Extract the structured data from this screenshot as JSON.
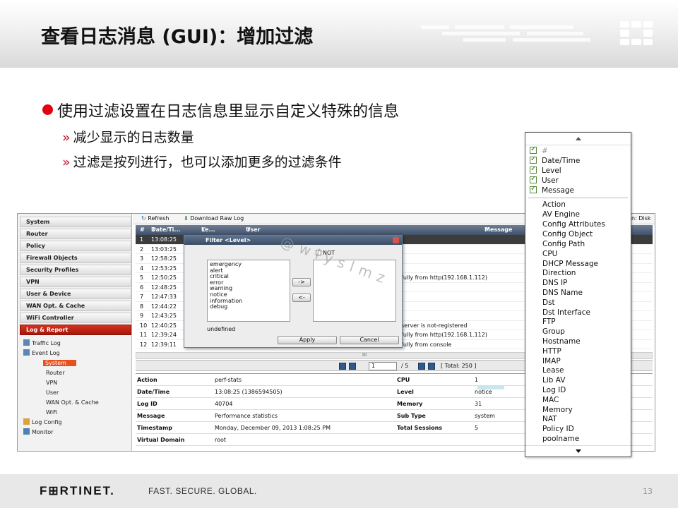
{
  "slide": {
    "title": "查看日志消息 (GUI)：增加过滤",
    "bullet_main": "使用过滤设置在日志信息里显示自定义特殊的信息",
    "sub_bullets": [
      "减少显示的日志数量",
      "过滤是按列进行，也可以添加更多的过滤条件"
    ],
    "sub_marker": "»",
    "footer_logo": "F⊞RTINET.",
    "footer_tagline": "FAST. SECURE. GLOBAL.",
    "page_number": "13",
    "watermark": "@wlyslmz"
  },
  "nav": {
    "items": [
      "System",
      "Router",
      "Policy",
      "Firewall Objects",
      "Security Profiles",
      "VPN",
      "User & Device",
      "WAN Opt. & Cache",
      "WiFi Controller",
      "Log & Report"
    ],
    "tree": {
      "traffic_log": "Traffic Log",
      "event_log": "Event Log",
      "children": [
        "System",
        "Router",
        "VPN",
        "User",
        "WAN Opt. & Cache",
        "WiFi"
      ],
      "log_config": "Log Config",
      "monitor": "Monitor"
    }
  },
  "toolbar": {
    "refresh": "Refresh",
    "download": "Download Raw Log",
    "disk_label": "n: Disk"
  },
  "grid": {
    "headers": {
      "num": "#",
      "datetime": "Date/Ti...",
      "level": "Le...",
      "user": "User",
      "message": "Message"
    },
    "rows": [
      {
        "n": "1",
        "t": "13:08:25",
        "m": ""
      },
      {
        "n": "2",
        "t": "13:03:25",
        "m": ""
      },
      {
        "n": "3",
        "t": "12:58:25",
        "m": ""
      },
      {
        "n": "4",
        "t": "12:53:25",
        "m": ""
      },
      {
        "n": "5",
        "t": "12:50:25",
        "m": "fully from http(192.168.1.112)"
      },
      {
        "n": "6",
        "t": "12:48:25",
        "m": ""
      },
      {
        "n": "7",
        "t": "12:47:33",
        "m": ""
      },
      {
        "n": "8",
        "t": "12:44:22",
        "m": ""
      },
      {
        "n": "9",
        "t": "12:43:25",
        "m": ""
      },
      {
        "n": "10",
        "t": "12:40:25",
        "m": "server is not-registered"
      },
      {
        "n": "11",
        "t": "12:39:24",
        "m": "fully from http(192.168.1.112)"
      },
      {
        "n": "12",
        "t": "12:39:11",
        "m": "fully from console"
      }
    ],
    "pager": {
      "page": "1",
      "of": "/ 5",
      "total": "[ Total: 250 ]"
    },
    "scroll_mark": "III"
  },
  "filter_dialog": {
    "title": "Filter <Level>",
    "not_label": "NOT",
    "levels": [
      "emergency",
      "alert",
      "critical",
      "error",
      "warning",
      "notice",
      "information",
      "debug"
    ],
    "add_btn": "->",
    "remove_btn": "<-",
    "undefined_label": "undefined",
    "apply": "Apply",
    "cancel": "Cancel"
  },
  "details": [
    {
      "k1": "Action",
      "v1": "perf-stats",
      "k2": "CPU",
      "v2": "1"
    },
    {
      "k1": "Date/Time",
      "v1": "13:08:25 (1386594505)",
      "k2": "Level",
      "v2": "notice"
    },
    {
      "k1": "Log ID",
      "v1": "40704",
      "k2": "Memory",
      "v2": "31"
    },
    {
      "k1": "Message",
      "v1": "Performance statistics",
      "k2": "Sub Type",
      "v2": "system"
    },
    {
      "k1": "Timestamp",
      "v1": "Monday, December 09, 2013 1:08:25 PM",
      "k2": "Total Sessions",
      "v2": "5"
    },
    {
      "k1": "Virtual Domain",
      "v1": "root",
      "k2": "",
      "v2": ""
    }
  ],
  "column_chooser": {
    "checked": [
      "#",
      "Date/Time",
      "Level",
      "User",
      "Message"
    ],
    "options": [
      "Action",
      "AV Engine",
      "Config Attributes",
      "Config Object",
      "Config Path",
      "CPU",
      "DHCP Message",
      "Direction",
      "DNS IP",
      "DNS Name",
      "Dst",
      "Dst Interface",
      "FTP",
      "Group",
      "Hostname",
      "HTTP",
      "IMAP",
      "Lease",
      "Lib AV",
      "Log ID",
      "MAC",
      "Memory",
      "NAT",
      "Policy ID",
      "poolname"
    ]
  }
}
